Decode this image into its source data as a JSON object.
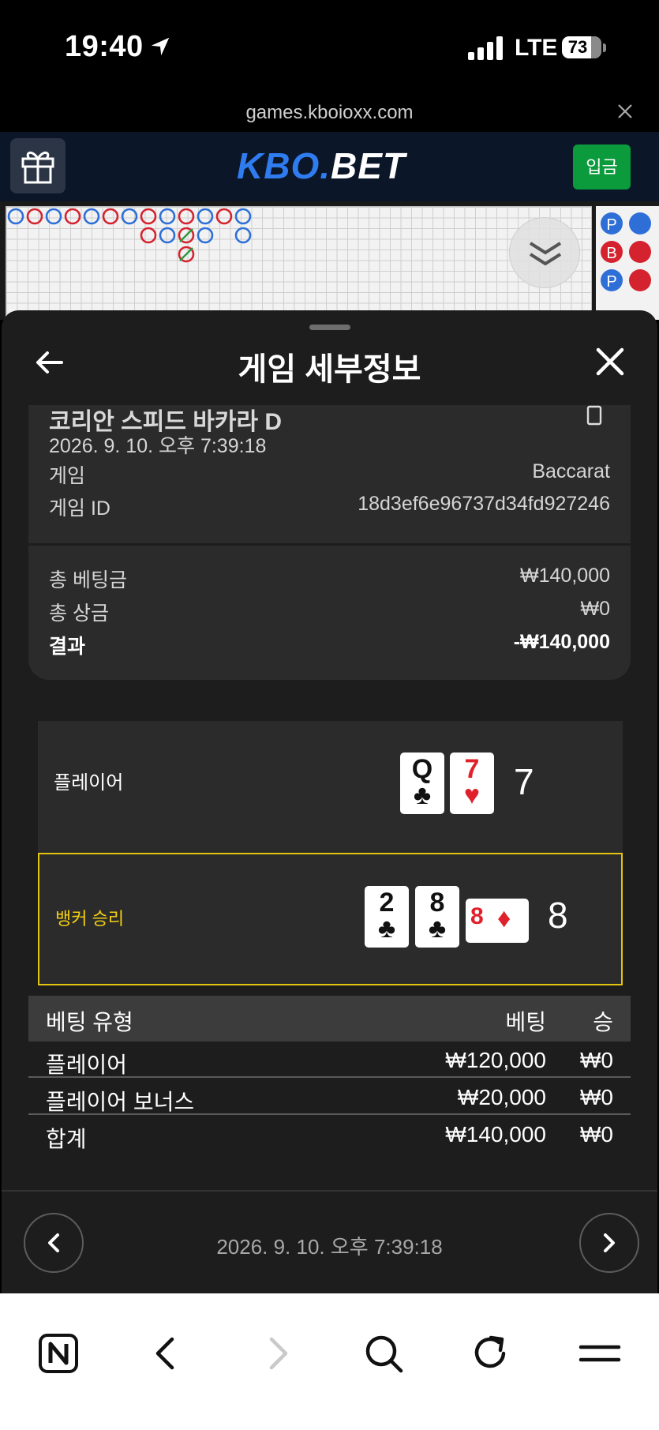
{
  "status_bar": {
    "time": "19:40",
    "network": "LTE",
    "battery": "73"
  },
  "browser": {
    "url": "games.kboioxx.com"
  },
  "header": {
    "logo_prefix": "KBO.",
    "logo_suffix": "BET",
    "deposit_label": "입금"
  },
  "sheet": {
    "title": "게임 세부정보",
    "game_name": "코리안 스피드 바카라 D",
    "datetime": "2026. 9. 10. 오후 7:39:18",
    "game_label": "게임",
    "game_value": "Baccarat",
    "game_id_label": "게임 ID",
    "game_id_value": "18d3ef6e96737d34fd927246",
    "total_bet_label": "총 베팅금",
    "total_bet_value": "₩140,000",
    "total_win_label": "총 상금",
    "total_win_value": "₩0",
    "result_label": "결과",
    "result_value": "-₩140,000"
  },
  "hands": {
    "player": {
      "label": "플레이어",
      "score": "7",
      "cards": [
        {
          "rank": "Q",
          "suit": "♣",
          "color": "black"
        },
        {
          "rank": "7",
          "suit": "♥",
          "color": "red"
        }
      ]
    },
    "banker": {
      "label": "뱅커 승리",
      "score": "8",
      "cards": [
        {
          "rank": "2",
          "suit": "♣",
          "color": "black"
        },
        {
          "rank": "8",
          "suit": "♣",
          "color": "black"
        },
        {
          "rank": "8",
          "suit": "♦",
          "color": "red"
        }
      ]
    }
  },
  "bet_table": {
    "headers": [
      "베팅 유형",
      "베팅",
      "승"
    ],
    "rows": [
      [
        "플레이어",
        "₩120,000",
        "₩0"
      ],
      [
        "플레이어 보너스",
        "₩20,000",
        "₩0"
      ],
      [
        "합계",
        "₩140,000",
        "₩0"
      ]
    ]
  },
  "footer": {
    "datetime": "2026. 9. 10. 오후 7:39:18"
  },
  "colors": {
    "accent_green": "#0b9a3c",
    "logo_blue": "#2f7cf0",
    "banker_highlight": "#e3c40e",
    "player_blue": "#2d6fd6",
    "banker_red": "#d4232e"
  }
}
